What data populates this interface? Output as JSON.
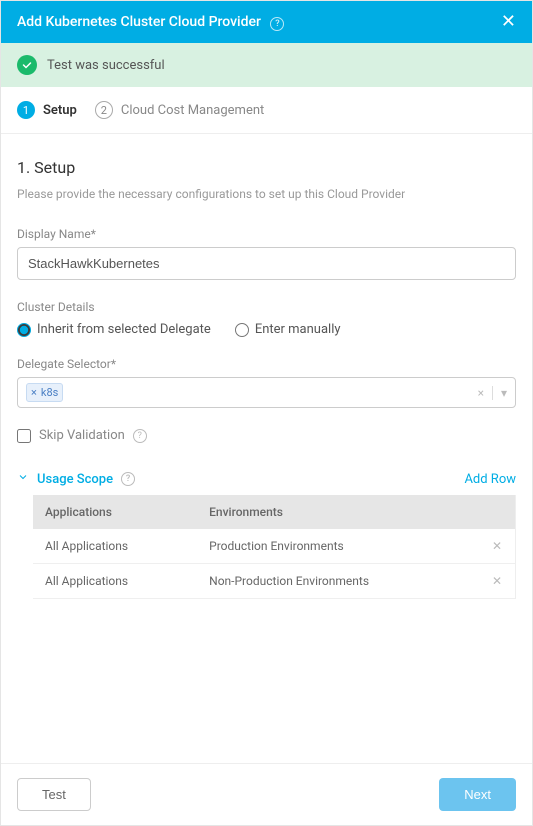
{
  "header": {
    "title": "Add Kubernetes Cluster Cloud Provider"
  },
  "banner": {
    "message": "Test was successful"
  },
  "steps": [
    {
      "num": "1",
      "label": "Setup",
      "active": true
    },
    {
      "num": "2",
      "label": "Cloud Cost Management",
      "active": false
    }
  ],
  "section": {
    "title": "1. Setup",
    "desc": "Please provide the necessary configurations to set up this Cloud Provider"
  },
  "displayName": {
    "label": "Display Name*",
    "value": "StackHawkKubernetes"
  },
  "clusterDetails": {
    "label": "Cluster Details",
    "options": {
      "inherit": "Inherit from selected Delegate",
      "manual": "Enter manually"
    }
  },
  "delegateSelector": {
    "label": "Delegate Selector*",
    "tag": "k8s"
  },
  "skipValidation": {
    "label": "Skip Validation"
  },
  "usageScope": {
    "label": "Usage Scope",
    "addRow": "Add Row",
    "headers": {
      "apps": "Applications",
      "envs": "Environments"
    },
    "rows": [
      {
        "app": "All Applications",
        "env": "Production Environments"
      },
      {
        "app": "All Applications",
        "env": "Non-Production Environments"
      }
    ]
  },
  "footer": {
    "test": "Test",
    "next": "Next"
  }
}
